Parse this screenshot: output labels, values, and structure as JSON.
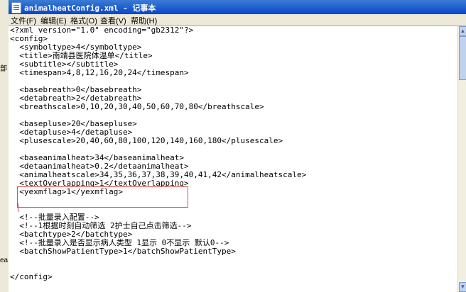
{
  "left_strip": {
    "fragments": [
      "部",
      "ea"
    ]
  },
  "window": {
    "title": "animalheatConfig.xml - 记事本"
  },
  "menu": {
    "items": [
      "文件(F)",
      "编辑(E)",
      "格式(O)",
      "查看(V)",
      "帮助(H)"
    ]
  },
  "document": {
    "lines": [
      "<?xml version=\"1.0\" encoding=\"gb2312\"?>",
      "<config>",
      "  <symboltype>4</symboltype>",
      "  <title>南靖县医院体温单</title>",
      "  <subtitle></subtitle>",
      "  <timespan>4,8,12,16,20,24</timespan>",
      "",
      "  <basebreath>0</basebreath>",
      "  <detabreath>2</detabreath>",
      "  <breathscale>0,10,20,30,40,50,60,70,80</breathscale>",
      "",
      "  <basepluse>20</basepluse>",
      "  <detapluse>4</detapluse>",
      "  <plusescale>20,40,60,80,100,120,140,160,180</plusescale>",
      "",
      "  <baseanimalheat>34</baseanimalheat>",
      "  <detaanimalheat>0.2</detaanimalheat>",
      "  <animalheatscale>34,35,36,37,38,39,40,41,42</animalheatscale>",
      "  <textOverlapping>1</textOverlapping>",
      "  <yexmflag>1</yexmflag>",
      "",
      "",
      "  <!--批量录入配置-->",
      "  <!--1根据时刻自动筛选 2护士自己点击筛选-->",
      "  <batchtype>2</batchtype>",
      "  <!--批量录入是否显示病人类型 1显示 0不显示 默认0-->",
      "  <batchShowPatientType>1</batchShowPatientType>",
      "",
      "",
      "</config>"
    ]
  }
}
